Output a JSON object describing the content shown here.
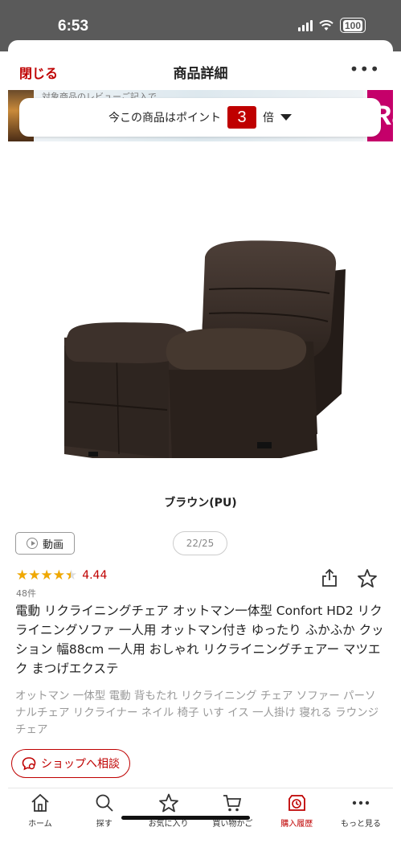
{
  "status_bar": {
    "time": "6:53",
    "battery": "100"
  },
  "header": {
    "close_label": "閉じる",
    "title": "商品詳細",
    "more_label": "•••"
  },
  "banner": {
    "promo_text": "対象商品のレビューご記入で",
    "right_text": "Ra"
  },
  "points": {
    "prefix": "今この商品はポイント",
    "multiplier": "3",
    "suffix": "倍"
  },
  "product": {
    "color_option": "ブラウン(PU)",
    "video_label": "動画",
    "image_pager": "22/25",
    "rating": {
      "value": "4.44",
      "fraction": 0.888,
      "count": "48件"
    },
    "title": "電動 リクライニングチェア オットマン一体型 Confort HD2 リクライニングソファ 一人用 オットマン付き ゆったり ふかふか クッション 幅88cm 一人用 おしゃれ リクライニングチェアー マツエク まつげエクステ",
    "keywords": "オットマン 一体型 電動 背もたれ リクライニング チェア ソファー パーソナルチェア リクライナー ネイル 椅子 いす イス 一人掛け 寝れる ラウンジチェア"
  },
  "consult_button": {
    "label": "ショップへ相談"
  },
  "tabbar": [
    {
      "label": "ホーム",
      "icon": "home-icon"
    },
    {
      "label": "探す",
      "icon": "search-icon"
    },
    {
      "label": "お気に入り",
      "icon": "star-icon"
    },
    {
      "label": "買い物かご",
      "icon": "cart-icon"
    },
    {
      "label": "購入履歴",
      "icon": "history-icon",
      "active": true
    },
    {
      "label": "もっと見る",
      "icon": "more-icon"
    }
  ],
  "colors": {
    "accent": "#bf0000",
    "star": "#f0a800",
    "muted": "#999999"
  }
}
